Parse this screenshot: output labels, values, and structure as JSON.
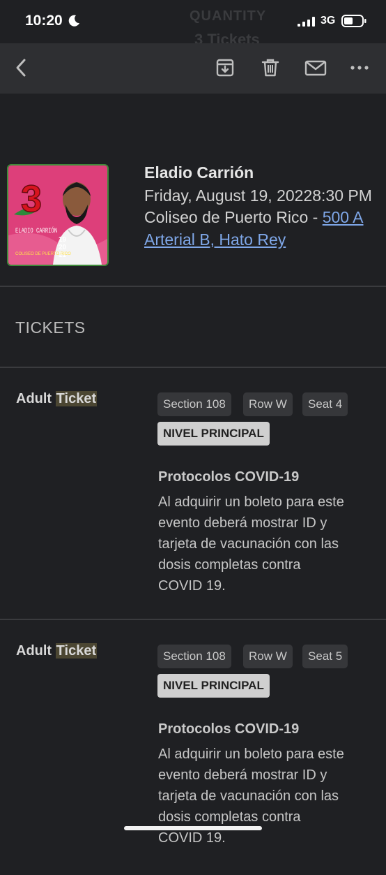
{
  "status_bar": {
    "time": "10:20",
    "network": "3G"
  },
  "background_header": {
    "quantity_label": "QUANTITY",
    "tickets_count": "3 Tickets"
  },
  "event": {
    "title": "Eladio Carrión",
    "date": "Friday, August 19, 20228:30 PM",
    "venue_prefix": "Coliseo de Puerto Rico - ",
    "venue_link": "500 A",
    "address_line2": "Arterial B, Hato Rey",
    "image_text": {
      "number": "3",
      "artist": "ELADIO CARRIÓN",
      "day1": "19",
      "day2": "20",
      "day3": "21",
      "venue": "COLISEO DE PUERTO RICO"
    }
  },
  "tickets_heading": "TICKETS",
  "tickets": [
    {
      "type_prefix": "Adult ",
      "type_highlight": "Ticket",
      "section": "Section 108",
      "row": "Row W",
      "seat": "Seat 4",
      "level": "NIVEL PRINCIPAL",
      "protocol_title": "Protocolos COVID-19",
      "protocol_lines": [
        "Al adquirir un boleto para este",
        "evento deberá mostrar ID y",
        "tarjeta de vacunación con las",
        "dosis completas contra",
        "COVID 19."
      ]
    },
    {
      "type_prefix": "Adult ",
      "type_highlight": "Ticket",
      "section": "Section 108",
      "row": "Row W",
      "seat": "Seat 5",
      "level": "NIVEL PRINCIPAL",
      "protocol_title": "Protocolos COVID-19",
      "protocol_lines": [
        "Al adquirir un boleto para este",
        "evento deberá mostrar ID y",
        "tarjeta de vacunación con las",
        "dosis completas contra",
        "COVID 19."
      ]
    }
  ],
  "icons": [
    "back-icon",
    "archive-icon",
    "trash-icon",
    "mail-icon",
    "more-icon"
  ],
  "colors": {
    "background": "#1f2023",
    "toolbar": "#2e2f32",
    "link": "#7fa7e8",
    "highlight": "#4b4632"
  }
}
